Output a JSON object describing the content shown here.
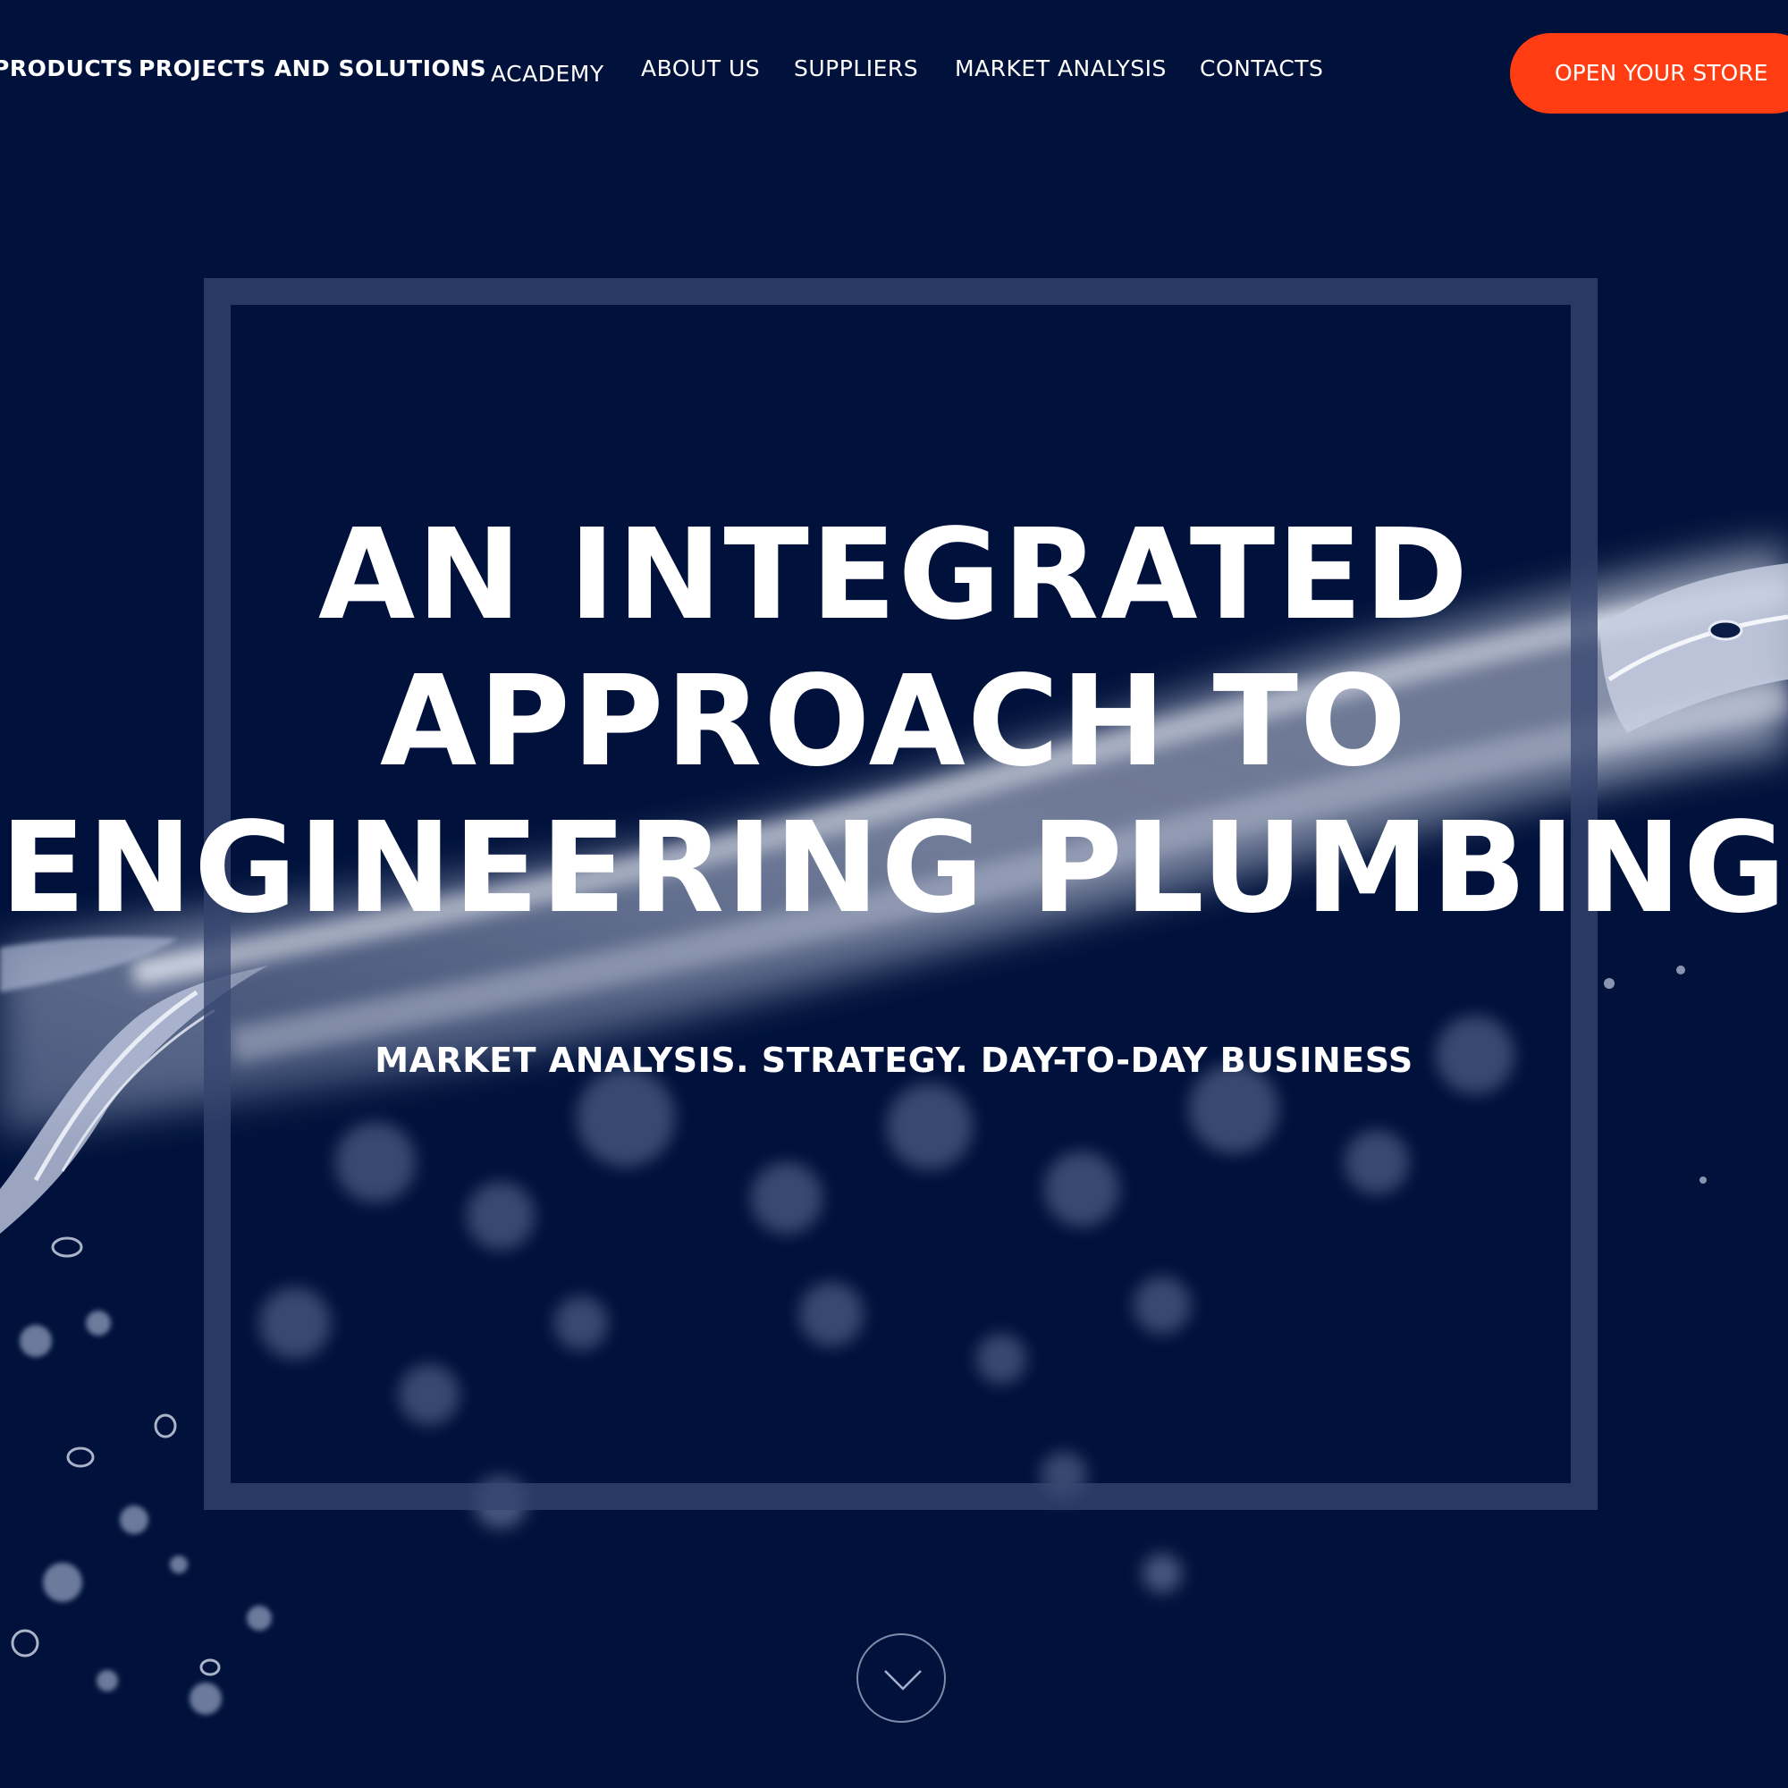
{
  "nav": {
    "items": [
      {
        "label": "PRODUCTS",
        "bold": true
      },
      {
        "label": "PROJECTS AND SOLUTIONS",
        "bold": true
      },
      {
        "label": "ACADEMY",
        "bold": false
      },
      {
        "label": "ABOUT US",
        "bold": false
      },
      {
        "label": "SUPPLIERS",
        "bold": false
      },
      {
        "label": "MARKET ANALYSIS",
        "bold": false
      },
      {
        "label": "CONTACTS",
        "bold": false
      }
    ],
    "cta_label": "OPEN YOUR STORE"
  },
  "hero": {
    "title_lines": [
      "AN INTEGRATED",
      "APPROACH TO",
      "ENGINEERING PLUMBING"
    ],
    "subtitle": "MARKET ANALYSIS. STRATEGY. DAY-TO-DAY BUSINESS"
  },
  "colors": {
    "background": "#00123b",
    "accent": "#ff3c12",
    "text": "#ffffff",
    "frame": "#34446e"
  },
  "icons": {
    "scroll_down": "chevron-down-icon"
  }
}
